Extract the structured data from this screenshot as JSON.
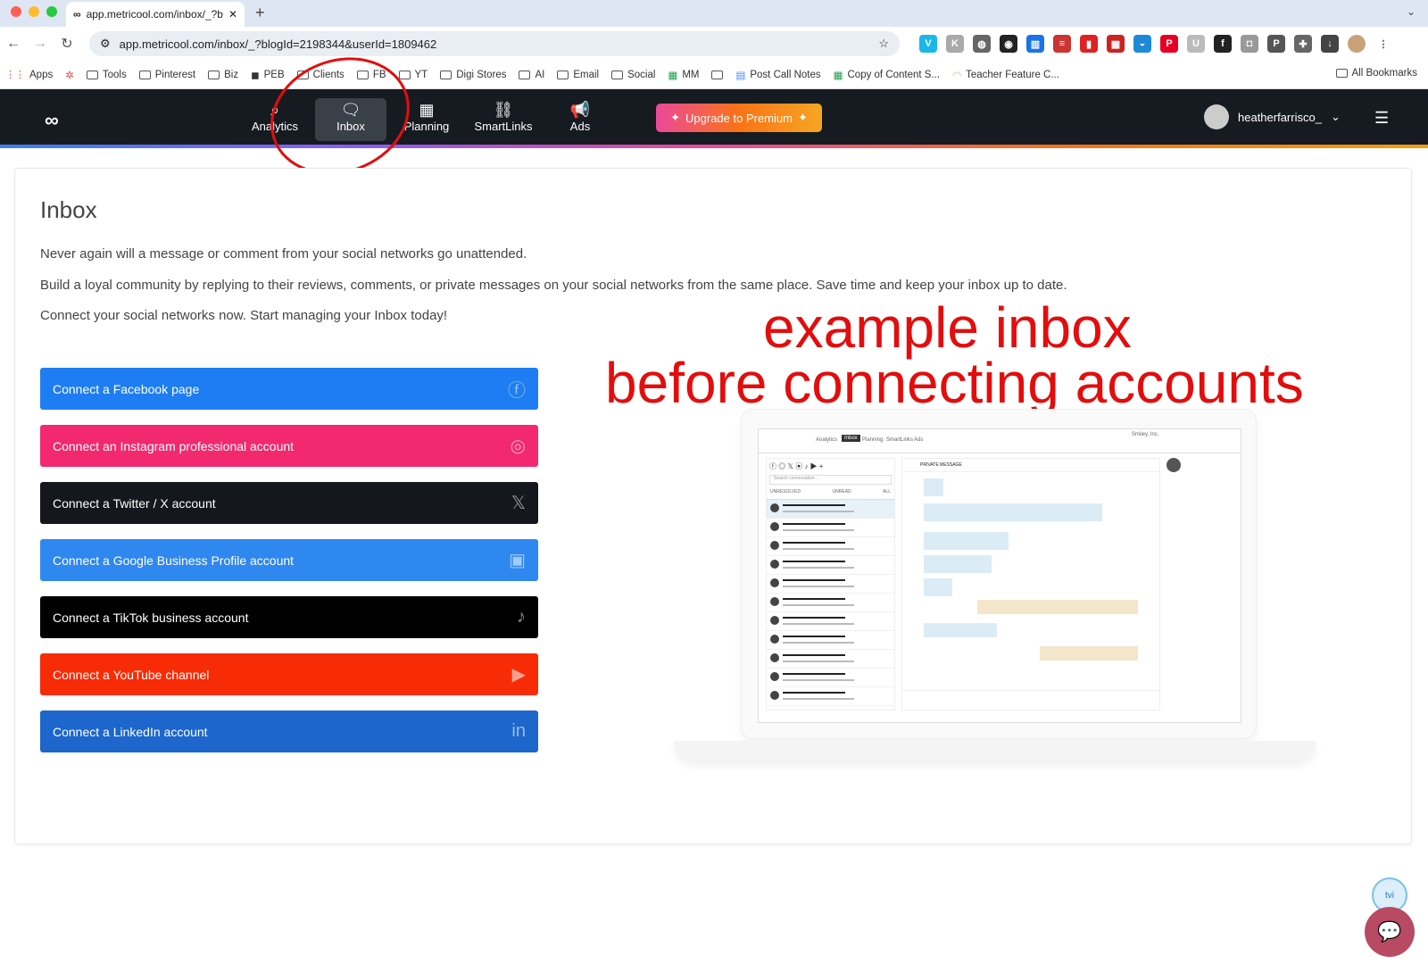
{
  "browser": {
    "tab_title": "app.metricool.com/inbox/_?b",
    "new_tab": "+",
    "url": "app.metricool.com/inbox/_?blogId=2198344&userId=1809462",
    "bookmarks": [
      {
        "icon": "apps-icon",
        "label": "Apps"
      },
      {
        "icon": "pinwheel-icon",
        "label": ""
      },
      {
        "icon": "folder-icon",
        "label": "Tools"
      },
      {
        "icon": "folder-icon",
        "label": "Pinterest"
      },
      {
        "icon": "folder-icon",
        "label": "Biz"
      },
      {
        "icon": "peb-icon",
        "label": "PEB"
      },
      {
        "icon": "folder-icon",
        "label": "Clients"
      },
      {
        "icon": "folder-icon",
        "label": "FB"
      },
      {
        "icon": "folder-icon",
        "label": "YT"
      },
      {
        "icon": "folder-icon",
        "label": "Digi Stores"
      },
      {
        "icon": "folder-icon",
        "label": "AI"
      },
      {
        "icon": "folder-icon",
        "label": "Email"
      },
      {
        "icon": "folder-icon",
        "label": "Social"
      },
      {
        "icon": "sheets-icon",
        "label": "MM"
      },
      {
        "icon": "folder-icon",
        "label": ""
      },
      {
        "icon": "docs-icon",
        "label": "Post Call Notes"
      },
      {
        "icon": "sheets-icon",
        "label": "Copy of Content S..."
      },
      {
        "icon": "rainbow-icon",
        "label": "Teacher Feature C..."
      }
    ],
    "all_bookmarks": "All Bookmarks"
  },
  "app": {
    "nav": [
      {
        "label": "Analytics",
        "icon": "analytics-icon",
        "glyph": "⌕"
      },
      {
        "label": "Inbox",
        "icon": "inbox-icon",
        "glyph": "🗨"
      },
      {
        "label": "Planning",
        "icon": "calendar-icon",
        "glyph": "▦"
      },
      {
        "label": "SmartLinks",
        "icon": "link-icon",
        "glyph": "⛓"
      },
      {
        "label": "Ads",
        "icon": "megaphone-icon",
        "glyph": "📢"
      }
    ],
    "upgrade_label": "Upgrade to Premium",
    "username": "heatherfarrisco_"
  },
  "page": {
    "title": "Inbox",
    "paragraphs": [
      "Never again will a message or comment from your social networks go unattended.",
      "Build a loyal community by replying to their reviews, comments, or private messages on your social networks from the same place. Save time and keep your inbox up to date.",
      "Connect your social networks now. Start managing your Inbox today!"
    ],
    "connect_buttons": [
      {
        "label": "Connect a Facebook page",
        "color": "#1e7df2",
        "icon": "facebook-icon",
        "glyph": "ⓕ"
      },
      {
        "label": "Connect an Instagram professional account",
        "color": "#f2296f",
        "icon": "instagram-icon",
        "glyph": "◎"
      },
      {
        "label": "Connect a Twitter / X account",
        "color": "#14171c",
        "icon": "x-icon",
        "glyph": "𝕏"
      },
      {
        "label": "Connect a Google Business Profile account",
        "color": "#2f87f0",
        "icon": "google-business-icon",
        "glyph": "▣"
      },
      {
        "label": "Connect a TikTok business account",
        "color": "#000000",
        "icon": "tiktok-icon",
        "glyph": "♪"
      },
      {
        "label": "Connect a YouTube channel",
        "color": "#f72c07",
        "icon": "youtube-icon",
        "glyph": "▶"
      },
      {
        "label": "Connect a LinkedIn account",
        "color": "#1c66cc",
        "icon": "linkedin-icon",
        "glyph": "in"
      }
    ]
  },
  "annotation": {
    "line1": "example inbox",
    "line2": "before connecting accounts"
  },
  "mockup": {
    "nav": [
      "Analytics",
      "Inbox",
      "Planning",
      "SmartLinks",
      "Ads"
    ],
    "search_placeholder": "Search conversation...",
    "tabs": [
      "UNRESOLVED",
      "UNREAD",
      "ALL"
    ],
    "chat_header": "PRIVATE MESSAGE",
    "account": "Smiley, Inc."
  }
}
